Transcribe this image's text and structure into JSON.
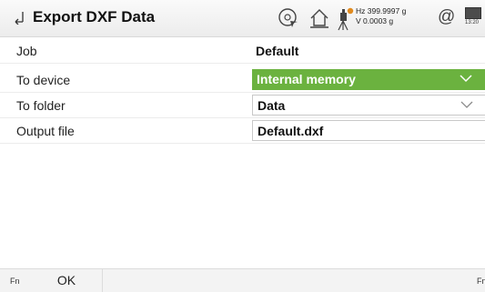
{
  "header": {
    "title": "Export DXF Data",
    "hz_line": "Hz 399.9997 g",
    "v_line": "V  0.0003 g",
    "at_symbol": "@",
    "time": "13:20",
    "icons": [
      "back-arrow-icon",
      "prism-target-icon",
      "home-station-icon",
      "instrument-icon",
      "at-icon",
      "battery-icon"
    ]
  },
  "form": {
    "job": {
      "label": "Job",
      "value": "Default"
    },
    "to_device": {
      "label": "To device",
      "value": "Internal memory"
    },
    "to_folder": {
      "label": "To folder",
      "value": "Data"
    },
    "output_file": {
      "label": "Output file",
      "value": "Default.dxf"
    }
  },
  "footer": {
    "fn_left": "Fn",
    "ok_label": "OK",
    "fn_right": "Fn"
  },
  "colors": {
    "selected_field": "#6bb23f",
    "accent_orange": "#e08a1e"
  }
}
